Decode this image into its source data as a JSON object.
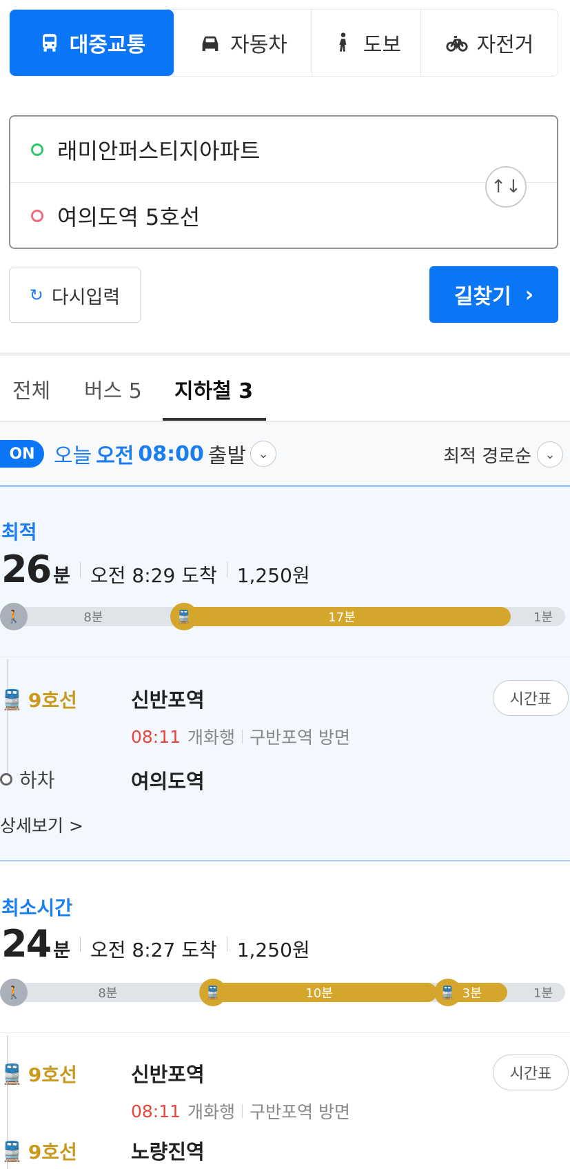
{
  "modes": [
    {
      "label": "대중교통",
      "icon": "bus-icon",
      "active": true
    },
    {
      "label": "자동차",
      "icon": "car-icon",
      "active": false
    },
    {
      "label": "도보",
      "icon": "walk-icon",
      "active": false
    },
    {
      "label": "자전거",
      "icon": "bicycle-icon",
      "active": false
    }
  ],
  "search": {
    "origin": "래미안퍼스티지아파트",
    "destination": "여의도역 5호선",
    "swap_icon": "↑↓"
  },
  "actions": {
    "reset_label": "다시입력",
    "reset_icon": "↻",
    "find_label": "길찾기",
    "find_icon": "›"
  },
  "filter_tabs": [
    {
      "label": "전체",
      "active": false
    },
    {
      "label": "버스 5",
      "active": false
    },
    {
      "label": "지하철 3",
      "active": true
    }
  ],
  "departure": {
    "toggle": "ON",
    "today": "오늘",
    "ampm": "오전",
    "time": "08:00",
    "depart": "출발",
    "chevron": "⌄",
    "sort": "최적 경로순"
  },
  "routes": [
    {
      "label": "최적",
      "minutes": "26",
      "unit": "분",
      "arrival": "오전 8:29 도착",
      "fare": "1,250원",
      "segments": [
        {
          "mode": "walk",
          "minutes": 8,
          "label": "8분"
        },
        {
          "mode": "subway",
          "minutes": 17,
          "label": "17분"
        },
        {
          "mode": "walk",
          "minutes": 1,
          "label": "1분"
        }
      ],
      "steps": [
        {
          "line": "9호선",
          "station": "신반포역",
          "depart_time": "08:11",
          "direction_train": "개화행",
          "direction": "구반포역 방면",
          "timetable": "시간표"
        },
        {
          "alight_label": "하차",
          "station": "여의도역"
        }
      ],
      "detail": "상세보기 >"
    },
    {
      "label": "최소시간",
      "minutes": "24",
      "unit": "분",
      "arrival": "오전 8:27 도착",
      "fare": "1,250원",
      "segments": [
        {
          "mode": "walk",
          "minutes": 8,
          "label": "8분"
        },
        {
          "mode": "subway",
          "minutes": 10,
          "label": "10분"
        },
        {
          "mode": "subway",
          "minutes": 3,
          "label": "3분"
        },
        {
          "mode": "walk",
          "minutes": 1,
          "label": "1분"
        }
      ],
      "steps": [
        {
          "line": "9호선",
          "station": "신반포역",
          "depart_time": "08:11",
          "direction_train": "개화행",
          "direction": "구반포역 방면",
          "timetable": "시간표"
        },
        {
          "line": "9호선",
          "station": "노량진역"
        }
      ]
    }
  ],
  "colors": {
    "accent": "#0a75f5",
    "subway_line9": "#d4a72c",
    "walk": "#a9b0ba",
    "time_red": "#e8453c"
  }
}
